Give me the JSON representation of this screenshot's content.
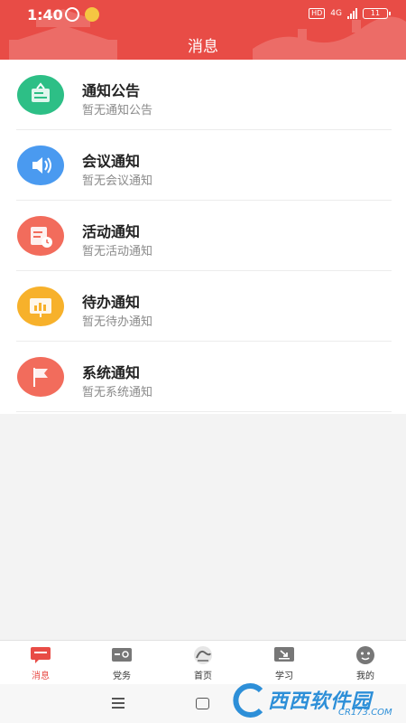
{
  "status_bar": {
    "time": "1:40",
    "hd_label": "HD",
    "network_label": "4G",
    "battery_level": "11"
  },
  "header": {
    "title": "消息"
  },
  "messages": [
    {
      "title": "通知公告",
      "subtitle": "暂无通知公告",
      "icon": "notice-board-icon",
      "color": "#2dbf86"
    },
    {
      "title": "会议通知",
      "subtitle": "暂无会议通知",
      "icon": "speaker-icon",
      "color": "#4a9af0"
    },
    {
      "title": "活动通知",
      "subtitle": "暂无活动通知",
      "icon": "calendar-clock-icon",
      "color": "#f26c5c"
    },
    {
      "title": "待办通知",
      "subtitle": "暂无待办通知",
      "icon": "chart-board-icon",
      "color": "#f7b12b"
    },
    {
      "title": "系统通知",
      "subtitle": "暂无系统通知",
      "icon": "flag-icon",
      "color": "#f26c5c"
    }
  ],
  "tabs": [
    {
      "label": "消息",
      "icon": "message-icon",
      "active": true
    },
    {
      "label": "党务",
      "icon": "party-affairs-icon",
      "active": false
    },
    {
      "label": "首页",
      "icon": "home-emblem-icon",
      "active": false
    },
    {
      "label": "学习",
      "icon": "study-icon",
      "active": false
    },
    {
      "label": "我的",
      "icon": "profile-icon",
      "active": false
    }
  ],
  "colors": {
    "accent": "#e84c46"
  },
  "watermark": {
    "text": "西西软件园",
    "sub": "CR173.COM"
  }
}
